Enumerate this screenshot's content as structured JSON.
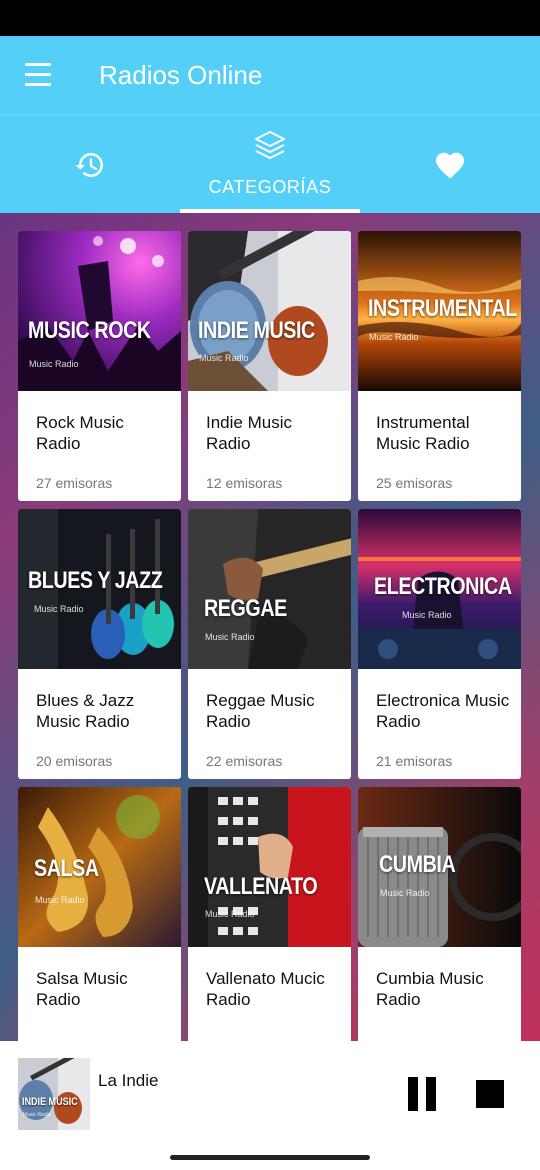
{
  "app": {
    "title": "Radios Online"
  },
  "tabs": [
    {
      "id": "history",
      "label": "",
      "icon": "history-icon"
    },
    {
      "id": "categories",
      "label": "CATEGORÍAS",
      "icon": "layers-icon",
      "selected": true
    },
    {
      "id": "favorites",
      "label": "",
      "icon": "heart-icon"
    }
  ],
  "categories": [
    {
      "art_title": "MUSIC ROCK",
      "art_sub": "Music Radio",
      "name": "Rock Music Radio",
      "count": "27 emisoras",
      "theme": "rock"
    },
    {
      "art_title": "INDIE MUSIC",
      "art_sub": "Music Radio",
      "name": "Indie Music Radio",
      "count": "12 emisoras",
      "theme": "indie"
    },
    {
      "art_title": "INSTRUMENTAL",
      "art_sub": "Music Radio",
      "name": "Instrumental Music Radio",
      "count": "25 emisoras",
      "theme": "instrumental"
    },
    {
      "art_title": "BLUES Y JAZZ",
      "art_sub": "Music Radio",
      "name": "Blues & Jazz Music Radio",
      "count": "20 emisoras",
      "theme": "blues"
    },
    {
      "art_title": "REGGAE",
      "art_sub": "Music Radio",
      "name": "Reggae Music Radio",
      "count": "22 emisoras",
      "theme": "reggae"
    },
    {
      "art_title": "ELECTRONICA",
      "art_sub": "Music Radio",
      "name": "Electronica Music Radio",
      "count": "21 emisoras",
      "theme": "electronica"
    },
    {
      "art_title": "SALSA",
      "art_sub": "Music Radio",
      "name": "Salsa Music Radio",
      "count": "",
      "theme": "salsa"
    },
    {
      "art_title": "VALLENATO",
      "art_sub": "Music Radio",
      "name": "Vallenato Mucic Radio",
      "count": "",
      "theme": "vallenato"
    },
    {
      "art_title": "CUMBIA",
      "art_sub": "Music Radio",
      "name": "Cumbia Music Radio",
      "count": "",
      "theme": "cumbia"
    }
  ],
  "player": {
    "station": "La Indie",
    "thumb_title": "INDIE MUSIC",
    "thumb_sub": "Music Radio",
    "state": "playing"
  },
  "colors": {
    "primary": "#54d0f8",
    "accent": "#ffffff"
  }
}
